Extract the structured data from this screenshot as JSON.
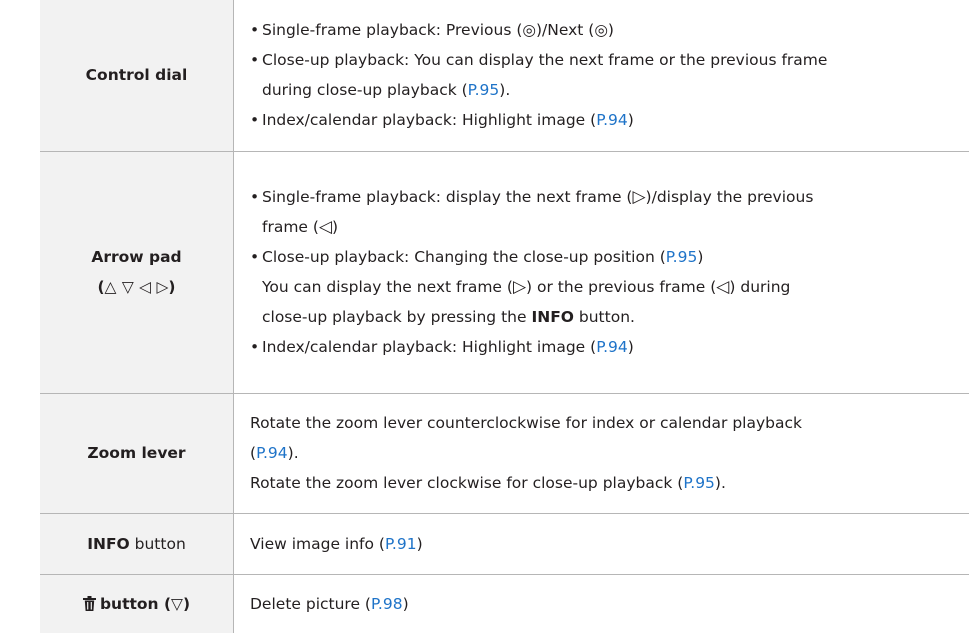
{
  "rows": [
    {
      "key": "Control dial",
      "items": [
        {
          "bullet": "•",
          "segments": [
            "Single-frame playback: Previous (",
            "◎",
            ")/Next (",
            "◎",
            ")"
          ]
        },
        {
          "bullet": "•",
          "lines": [
            "Close-up playback: You can display the next frame or the previous frame",
            "during close-up playback ("
          ],
          "link": "P.95",
          "after": ")."
        },
        {
          "bullet": "•",
          "text": "Index/calendar playback: Highlight image (",
          "link": "P.94",
          "after": ")"
        }
      ]
    },
    {
      "key_line1": "Arrow pad",
      "key_line2": "(△ ▽ ◁ ▷)",
      "items": [
        {
          "bullet": "•",
          "text1": "Single-frame playback: display the next frame (",
          "g1": "▷",
          "text2": ")/display the previous",
          "text3": "frame (",
          "g2": "◁",
          "text4": ")"
        },
        {
          "bullet": "•",
          "text": "Close-up playback: Changing the close-up position (",
          "link": "P.95",
          "after": ")",
          "cont1a": "You can display the next frame (",
          "cg1": "▷",
          "cont1b": ") or the previous frame (",
          "cg2": "◁",
          "cont1c": ") during",
          "cont2a": "close-up playback by pressing the ",
          "cont2b": "INFO",
          "cont2c": " button."
        },
        {
          "bullet": "•",
          "text": "Index/calendar playback: Highlight image (",
          "link": "P.94",
          "after": ")"
        }
      ]
    },
    {
      "key": "Zoom lever",
      "line1": "Rotate the zoom lever counterclockwise for index or calendar playback",
      "line2_pre": "(",
      "line2_link": "P.94",
      "line2_post": ").",
      "line3_pre": "Rotate the zoom lever clockwise for close-up playback (",
      "line3_link": "P.95",
      "line3_post": ")."
    },
    {
      "key_bold": "INFO",
      "key_rest": " button",
      "pre": "View image info (",
      "link": "P.91",
      "post": ")"
    },
    {
      "key_icon": "trash-icon",
      "key_bold": "button (▽)",
      "pre": "Delete picture (",
      "link": "P.98",
      "post": ")"
    }
  ]
}
